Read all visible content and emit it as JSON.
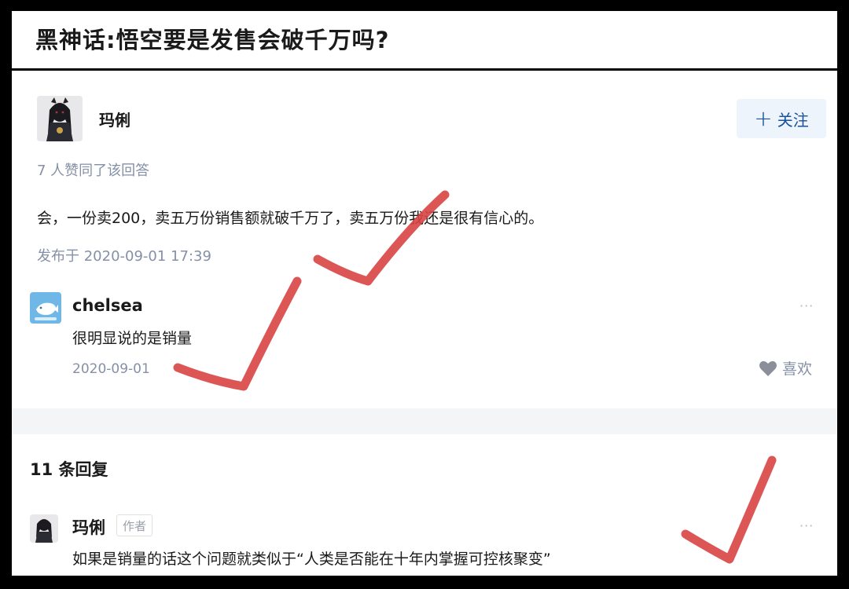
{
  "question": {
    "title": "黑神话:悟空要是发售会破千万吗?"
  },
  "answer": {
    "author": "玛俐",
    "follow_label": "关注",
    "votes": "7 人赞同了该回答",
    "content": "会，一份卖200，卖五万份销售额就破千万了，卖五万份我还是很有信心的。",
    "published": "发布于 2020-09-01 17:39"
  },
  "comment": {
    "author": "chelsea",
    "content": "很明显说的是销量",
    "date": "2020-09-01",
    "more": "···",
    "like_label": "喜欢"
  },
  "replies": {
    "count_label": "11 条回复",
    "first": {
      "author": "玛俐",
      "tag": "作者",
      "content": "如果是销量的话这个问题就类似于“人类是否能在十年内掌握可控核聚变”",
      "more": "···"
    }
  },
  "colors": {
    "check_mark": "#d94444",
    "link_blue": "#175199",
    "meta_gray": "#8590a6"
  },
  "icons": [
    "plus-icon",
    "heart-icon",
    "avatar-anime-girl",
    "avatar-whale",
    "check-mark"
  ]
}
